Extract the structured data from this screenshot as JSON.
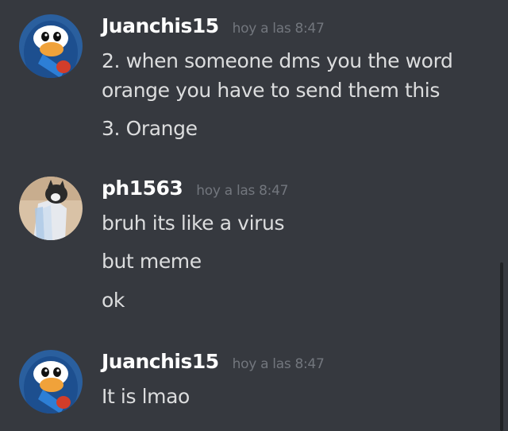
{
  "messages": [
    {
      "username": "Juanchis15",
      "timestamp": "hoy a las 8:47",
      "avatar_icon": "penguin-avatar-icon",
      "lines": [
        "2. when someone dms you the word",
        "orange you have to send them this",
        "3. Orange"
      ]
    },
    {
      "username": "ph1563",
      "timestamp": "hoy a las 8:47",
      "avatar_icon": "cat-photo-avatar-icon",
      "lines": [
        "bruh its like a virus",
        "but meme",
        "ok"
      ]
    },
    {
      "username": "Juanchis15",
      "timestamp": "hoy a las 8:47",
      "avatar_icon": "penguin-avatar-icon",
      "lines": [
        "It is lmao"
      ]
    }
  ],
  "colors": {
    "background": "#36393f",
    "username": "#ffffff",
    "timestamp": "#72767d",
    "message_text": "#dcddde",
    "scrollbar": "#202225"
  }
}
